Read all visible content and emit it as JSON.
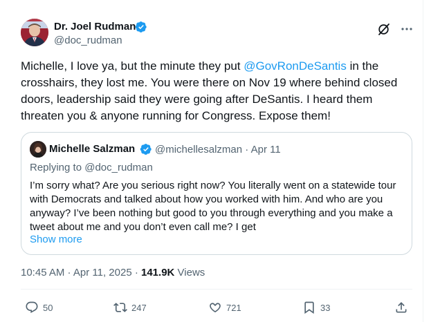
{
  "author": {
    "name": "Dr. Joel Rudman",
    "handle": "@doc_rudman"
  },
  "tweet": {
    "text_before": "Michelle, I love ya, but the minute they put ",
    "mention": "@GovRonDeSantis",
    "text_after": " in the crosshairs, they lost me. You were there on Nov 19 where behind closed doors, leadership said they were going after DeSantis. I heard them threaten you & anyone running for Congress. Expose them!"
  },
  "quote": {
    "name": "Michelle Salzman",
    "meta": "@michellesalzman · Apr 11",
    "replying_to": "Replying to @doc_rudman",
    "body": "I’m sorry what? Are you serious right now? You literally went on a statewide tour with Democrats and talked about how you worked with him. And who are you anyway? I’ve been nothing but good to you through everything and you make a tweet about me and you don’t even call me? I get",
    "show_more": "Show more"
  },
  "meta": {
    "time_date": "10:45 AM · Apr 11, 2025 · ",
    "views_count": "141.9K",
    "views_label": " Views"
  },
  "actions": {
    "replies": "50",
    "retweets": "247",
    "likes": "721",
    "bookmarks": "33"
  },
  "colors": {
    "accent": "#1d9bf0",
    "muted": "#536471",
    "text": "#0f1419",
    "border": "#cfd9de"
  },
  "icons": [
    "verified-badge-icon",
    "grok-icon",
    "more-icon",
    "reply-icon",
    "retweet-icon",
    "like-icon",
    "bookmark-icon",
    "share-icon"
  ]
}
